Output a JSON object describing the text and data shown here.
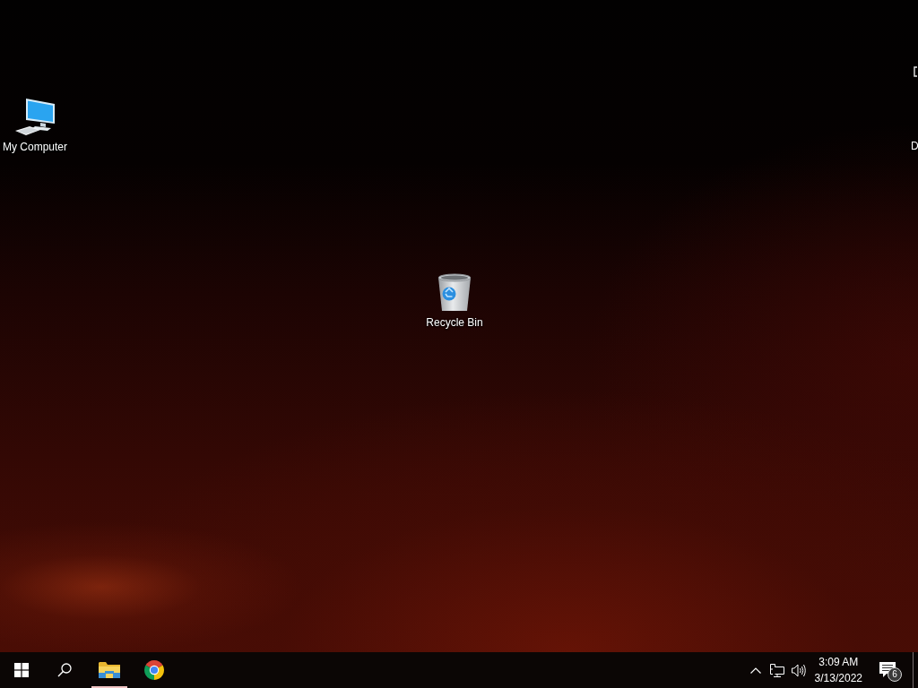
{
  "desktop": {
    "icons": [
      {
        "kind": "computer",
        "label": "My Computer"
      },
      {
        "kind": "recycle-bin",
        "label": "Recycle Bin"
      },
      {
        "kind": "edge-fragment"
      },
      {
        "kind": "edge-label",
        "label": "D"
      }
    ]
  },
  "taskbar": {
    "apps": [
      {
        "kind": "explorer",
        "running": true
      },
      {
        "kind": "browser",
        "running": false
      }
    ],
    "tray": {
      "time": "3:09 AM",
      "date": "3/13/2022",
      "notification_count": "6"
    }
  }
}
